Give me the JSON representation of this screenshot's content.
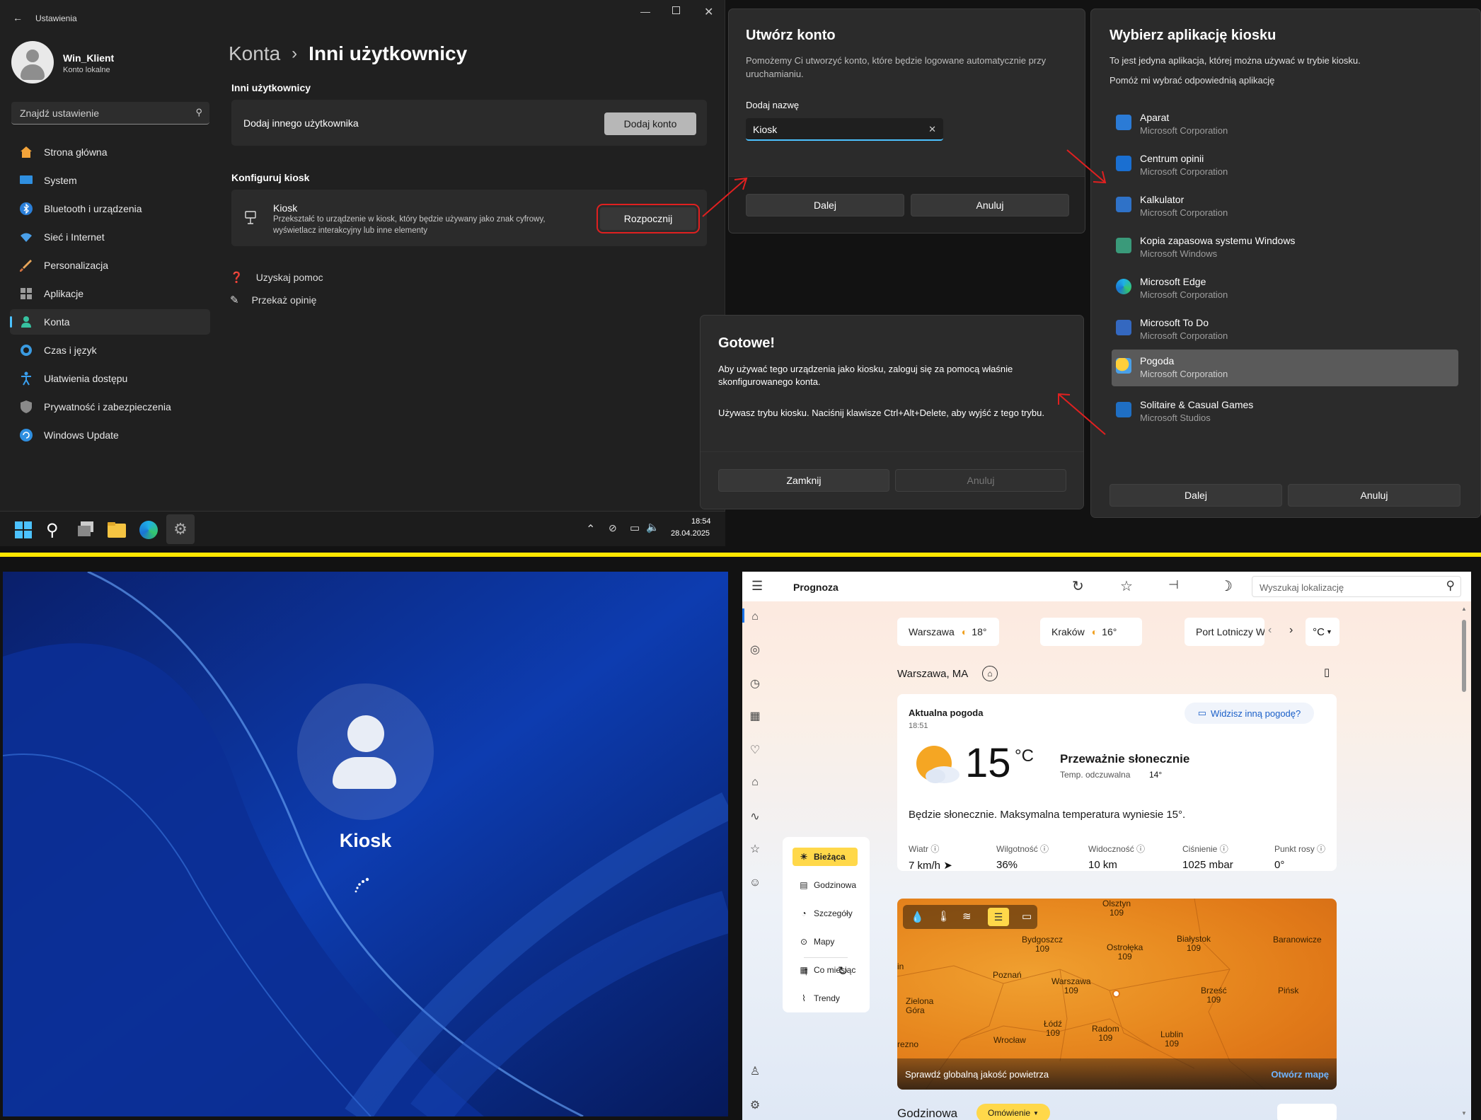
{
  "settings": {
    "title": "Ustawienia",
    "user_name": "Win_Klient",
    "user_type": "Konto lokalne",
    "search_placeholder": "Znajdź ustawienie",
    "nav": [
      {
        "label": "Strona główna",
        "icon": "home-icon"
      },
      {
        "label": "System",
        "icon": "system-icon"
      },
      {
        "label": "Bluetooth i urządzenia",
        "icon": "bluetooth-icon"
      },
      {
        "label": "Sieć i Internet",
        "icon": "wifi-icon"
      },
      {
        "label": "Personalizacja",
        "icon": "brush-icon"
      },
      {
        "label": "Aplikacje",
        "icon": "apps-icon"
      },
      {
        "label": "Konta",
        "icon": "accounts-icon"
      },
      {
        "label": "Czas i język",
        "icon": "time-language-icon"
      },
      {
        "label": "Ułatwienia dostępu",
        "icon": "accessibility-icon"
      },
      {
        "label": "Prywatność i zabezpieczenia",
        "icon": "shield-icon"
      },
      {
        "label": "Windows Update",
        "icon": "update-icon"
      }
    ],
    "breadcrumb_parent": "Konta",
    "breadcrumb_sep": "›",
    "breadcrumb_current": "Inni użytkownicy",
    "section_other": "Inni użytkownicy",
    "add_user_text": "Dodaj innego użytkownika",
    "add_account_btn": "Dodaj konto",
    "section_kiosk": "Konfiguruj kiosk",
    "kiosk_title": "Kiosk",
    "kiosk_desc_1": "Przekształć to urządzenie w kiosk, który będzie używany jako znak cyfrowy,",
    "kiosk_desc_2": "wyświetlacz interakcyjny lub inne elementy",
    "kiosk_start_btn": "Rozpocznij",
    "help_link": "Uzyskaj pomoc",
    "feedback_link": "Przekaż opinię"
  },
  "taskbar": {
    "time": "18:54",
    "date": "28.04.2025"
  },
  "create_account": {
    "title": "Utwórz konto",
    "desc_1": "Pomożemy Ci utworzyć konto, które będzie logowane automatycznie przy",
    "desc_2": "uruchamianiu.",
    "name_label": "Dodaj nazwę",
    "name_value": "Kiosk",
    "next_btn": "Dalej",
    "cancel_btn": "Anuluj"
  },
  "done_dialog": {
    "title": "Gotowe!",
    "line_1": "Aby używać tego urządzenia jako kiosku, zaloguj się za pomocą właśnie",
    "line_2": "skonfigurowanego konta.",
    "line_3": "Używasz trybu kiosku. Naciśnij klawisze Ctrl+Alt+Delete, aby wyjść z tego trybu.",
    "close_btn": "Zamknij",
    "cancel_btn": "Anuluj"
  },
  "kiosk_app": {
    "title": "Wybierz aplikację kiosku",
    "desc": "To jest jedyna aplikacja, której można używać w trybie kiosku.",
    "help_link": "Pomóż mi wybrać odpowiednią aplikację",
    "apps": [
      {
        "name": "Aparat",
        "publisher": "Microsoft Corporation",
        "color": "#2b7bd6"
      },
      {
        "name": "Centrum opinii",
        "publisher": "Microsoft Corporation",
        "color": "#1a6fd1"
      },
      {
        "name": "Kalkulator",
        "publisher": "Microsoft Corporation",
        "color": "#2f72c8"
      },
      {
        "name": "Kopia zapasowa systemu Windows",
        "publisher": "Microsoft Windows",
        "color": "#3a9a7a"
      },
      {
        "name": "Microsoft Edge",
        "publisher": "Microsoft Corporation",
        "color": "#1da0c8"
      },
      {
        "name": "Microsoft To Do",
        "publisher": "Microsoft Corporation",
        "color": "#3468c0"
      },
      {
        "name": "Pogoda",
        "publisher": "Microsoft Corporation",
        "color": "#f0a020"
      },
      {
        "name": "Solitaire & Casual Games",
        "publisher": "Microsoft Studios",
        "color": "#1f6fc4"
      }
    ],
    "next_btn": "Dalej",
    "cancel_btn": "Anuluj"
  },
  "lock_screen": {
    "user": "Kiosk"
  },
  "weather": {
    "title": "Prognoza",
    "search_placeholder": "Wyszukaj lokalizację",
    "cities": [
      {
        "name": "Warszawa",
        "temp": "18°"
      },
      {
        "name": "Kraków",
        "temp": "16°"
      },
      {
        "name": "Port Lotniczy W",
        "temp": ""
      }
    ],
    "unit_toggle": "°C",
    "location": "Warszawa, MA",
    "current_label": "Aktualna pogoda",
    "current_time": "18:51",
    "feedback": "Widzisz inną pogodę?",
    "temp": "15",
    "temp_unit": "°C",
    "condition": "Przeważnie słonecznie",
    "feels_like_label": "Temp. odczuwalna",
    "feels_like": "14°",
    "summary": "Będzie słonecznie. Maksymalna temperatura wyniesie 15°.",
    "metrics": [
      {
        "label": "Wiatr",
        "value": "7 km/h"
      },
      {
        "label": "Wilgotność",
        "value": "36%"
      },
      {
        "label": "Widoczność",
        "value": "10 km"
      },
      {
        "label": "Ciśnienie",
        "value": "1025 mbar"
      },
      {
        "label": "Punkt rosy",
        "value": "0°"
      }
    ],
    "nav": [
      {
        "label": "Bieżąca",
        "icon": "sun-icon"
      },
      {
        "label": "Godzinowa",
        "icon": "hourly-icon"
      },
      {
        "label": "Szczegóły",
        "icon": "details-icon"
      },
      {
        "label": "Mapy",
        "icon": "map-pin-icon"
      },
      {
        "label": "Co miesiąc",
        "icon": "calendar-icon"
      },
      {
        "label": "Trendy",
        "icon": "trend-icon"
      }
    ],
    "map_cities": [
      {
        "name": "Olsztyn",
        "val": "109"
      },
      {
        "name": "Białystok",
        "val": "109"
      },
      {
        "name": "Bydgoszcz",
        "val": "109"
      },
      {
        "name": "Ostrołęka",
        "val": "109"
      },
      {
        "name": "Baranowicze",
        "val": ""
      },
      {
        "name": "Poznań",
        "val": ""
      },
      {
        "name": "Warszawa",
        "val": "109"
      },
      {
        "name": "Brześć",
        "val": "109"
      },
      {
        "name": "Pińsk",
        "val": ""
      },
      {
        "name": "Zielona Góra",
        "val": ""
      },
      {
        "name": "Łódź",
        "val": "109"
      },
      {
        "name": "Radom",
        "val": "109"
      },
      {
        "name": "Lublin",
        "val": "109"
      },
      {
        "name": "Wrocław",
        "val": ""
      },
      {
        "name": "in",
        "val": ""
      },
      {
        "name": "rezno",
        "val": ""
      }
    ],
    "air_quality": "Sprawdź globalną jakość powietrza",
    "open_map": "Otwórz mapę",
    "hourly_label": "Godzinowa",
    "discuss_btn": "Omówienie"
  }
}
